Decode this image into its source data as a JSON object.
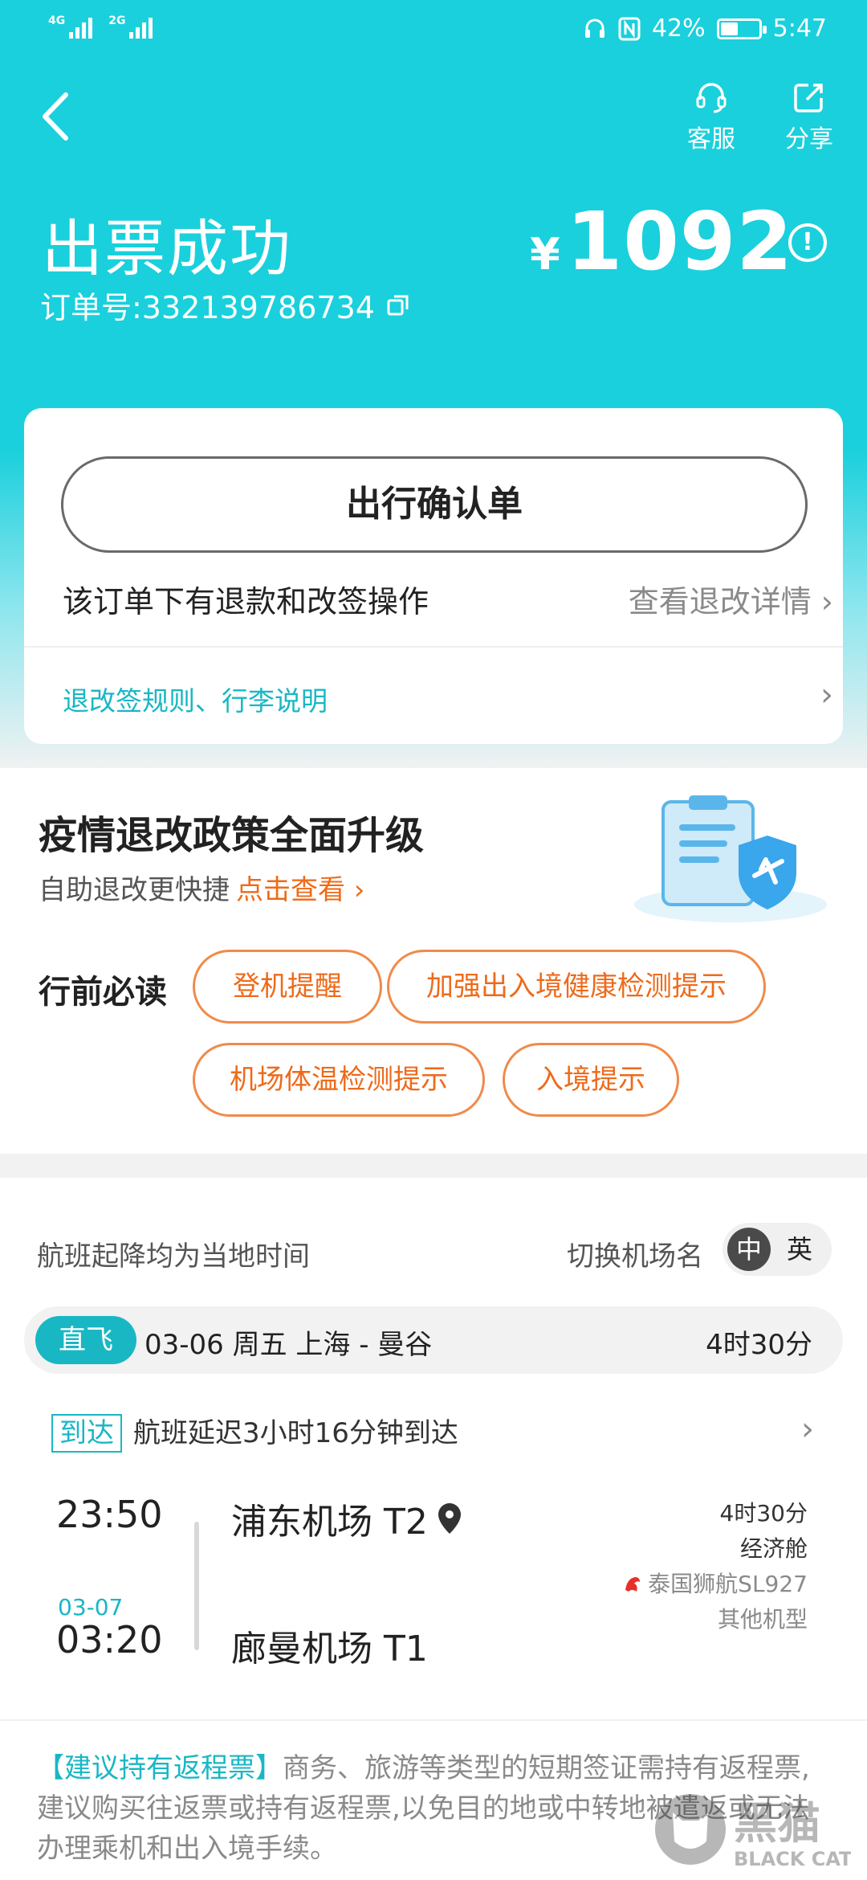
{
  "status_bar": {
    "net1": "4G",
    "net2": "2G",
    "battery": "42%",
    "time": "5:47"
  },
  "header": {
    "service_label": "客服",
    "share_label": "分享",
    "title": "出票成功",
    "order_no": "订单号:332139786734",
    "currency": "¥",
    "price": "1092"
  },
  "card": {
    "confirm_button": "出行确认单",
    "refund_text": "该订单下有退款和改签操作",
    "refund_detail": "查看退改详情",
    "rules_link": "退改签规则、行李说明"
  },
  "policy": {
    "title": "疫情退改政策全面升级",
    "subtitle": "自助退改更快捷",
    "link": "点击查看",
    "must_read": "行前必读",
    "tags": [
      "登机提醒",
      "加强出入境健康检测提示",
      "机场体温检测提示",
      "入境提示"
    ]
  },
  "flight": {
    "local_time_note": "航班起降均为当地时间",
    "switch_label": "切换机场名",
    "switch_on": "中",
    "switch_off": "英",
    "badge": "直飞",
    "route": "03-06  周五  上海 - 曼谷",
    "duration": "4时30分",
    "arrive_label": "到达",
    "arrive_text": "航班延迟3小时16分钟到达",
    "depart_time": "23:50",
    "arrive_date": "03-07",
    "arrive_time": "03:20",
    "depart_airport": "浦东机场 T2",
    "arrive_airport": "廊曼机场 T1",
    "meta_duration": "4时30分",
    "cabin": "经济舱",
    "airline": "泰国狮航SL927",
    "aircraft": "其他机型"
  },
  "notice": {
    "highlight": "【建议持有返程票】",
    "text": "商务、旅游等类型的短期签证需持有返程票,建议购买往返票或持有返程票,以免目的地或中转地被遣返或无法办理乘机和出入境手续。"
  },
  "watermark": {
    "text": "黑猫",
    "sub": "BLACK CAT"
  },
  "colors": {
    "accent": "#1ad0dc",
    "link": "#19b7c4",
    "orange": "#ef6a18"
  }
}
